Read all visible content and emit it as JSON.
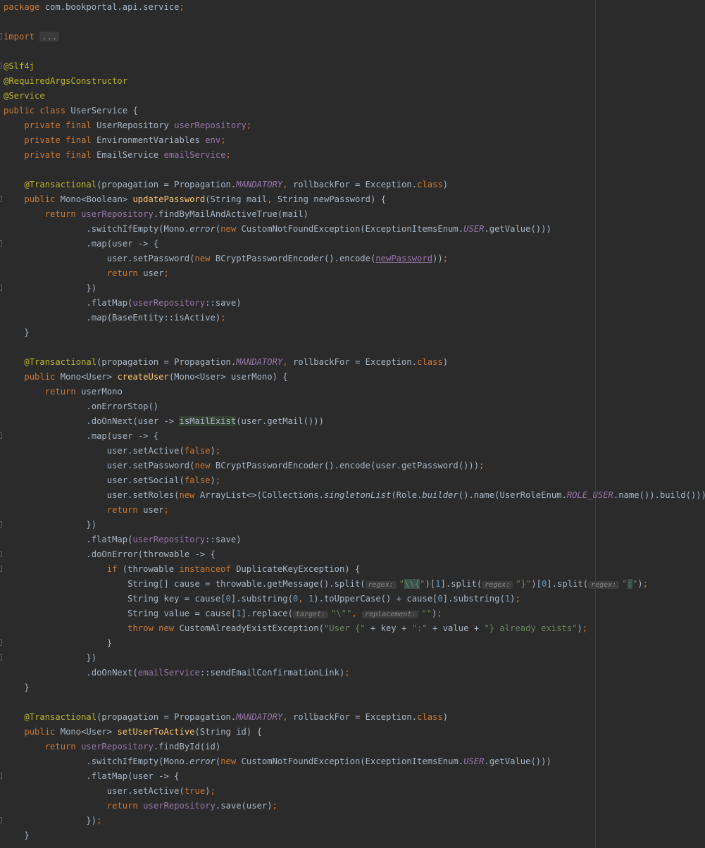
{
  "editor": {
    "language": "java",
    "colors": {
      "background": "#2b2b2b",
      "keyword": "#cc7832",
      "annotation": "#bbb529",
      "field": "#9876aa",
      "method_decl": "#ffc66d",
      "string": "#6a8759",
      "number": "#6897bb",
      "default": "#a9b7c6"
    },
    "lines": [
      [
        [
          "kw",
          "package "
        ],
        [
          "t",
          "com.bookportal.api.service"
        ],
        [
          "kw",
          ";"
        ]
      ],
      [],
      [
        [
          "kw",
          "import "
        ],
        [
          "fold",
          "..."
        ]
      ],
      [],
      [
        [
          "ann",
          "@Slf4j"
        ]
      ],
      [
        [
          "ann",
          "@RequiredArgsConstructor"
        ]
      ],
      [
        [
          "ann",
          "@Service"
        ]
      ],
      [
        [
          "kw",
          "public class "
        ],
        [
          "t",
          "UserService {"
        ]
      ],
      [
        [
          "t",
          "    "
        ],
        [
          "kw",
          "private final "
        ],
        [
          "t",
          "UserRepository "
        ],
        [
          "fld",
          "userRepository"
        ],
        [
          "kw",
          ";"
        ]
      ],
      [
        [
          "t",
          "    "
        ],
        [
          "kw",
          "private final "
        ],
        [
          "t",
          "EnvironmentVariables "
        ],
        [
          "fld",
          "env"
        ],
        [
          "kw",
          ";"
        ]
      ],
      [
        [
          "t",
          "    "
        ],
        [
          "kw",
          "private final "
        ],
        [
          "t",
          "EmailService "
        ],
        [
          "fld",
          "emailService"
        ],
        [
          "kw",
          ";"
        ]
      ],
      [],
      [
        [
          "t",
          "    "
        ],
        [
          "ann",
          "@Transactional"
        ],
        [
          "t",
          "(propagation = Propagation."
        ],
        [
          "fldit",
          "MANDATORY"
        ],
        [
          "kw",
          ","
        ],
        [
          "t",
          " rollbackFor = Exception."
        ],
        [
          "kw",
          "class"
        ],
        [
          "t",
          ")"
        ]
      ],
      [
        [
          "t",
          "    "
        ],
        [
          "kw",
          "public "
        ],
        [
          "t",
          "Mono<Boolean> "
        ],
        [
          "fn",
          "updatePassword"
        ],
        [
          "t",
          "(String mail"
        ],
        [
          "kw",
          ","
        ],
        [
          "t",
          " String newPassword) {"
        ]
      ],
      [
        [
          "t",
          "        "
        ],
        [
          "kw",
          "return "
        ],
        [
          "fld",
          "userRepository"
        ],
        [
          "t",
          ".findByMailAndActiveTrue(mail)"
        ]
      ],
      [
        [
          "t",
          "                .switchIfEmpty(Mono."
        ],
        [
          "it",
          "error"
        ],
        [
          "t",
          "("
        ],
        [
          "kw",
          "new "
        ],
        [
          "t",
          "CustomNotFoundException(ExceptionItemsEnum."
        ],
        [
          "fldit",
          "USER"
        ],
        [
          "t",
          ".getValue()))"
        ]
      ],
      [
        [
          "t",
          "                .map(user -> {"
        ]
      ],
      [
        [
          "t",
          "                    user.setPassword("
        ],
        [
          "kw",
          "new "
        ],
        [
          "t",
          "BCryptPasswordEncoder().encode("
        ],
        [
          "ulf",
          "newPassword"
        ],
        [
          "t",
          "))"
        ],
        [
          "kw",
          ";"
        ]
      ],
      [
        [
          "t",
          "                    "
        ],
        [
          "kw",
          "return "
        ],
        [
          "t",
          "user"
        ],
        [
          "kw",
          ";"
        ]
      ],
      [
        [
          "t",
          "                })"
        ]
      ],
      [
        [
          "t",
          "                .flatMap("
        ],
        [
          "fld",
          "userRepository"
        ],
        [
          "t",
          "::save)"
        ]
      ],
      [
        [
          "t",
          "                .map(BaseEntity::isActive)"
        ],
        [
          "kw",
          ";"
        ]
      ],
      [
        [
          "t",
          "    }"
        ]
      ],
      [],
      [
        [
          "t",
          "    "
        ],
        [
          "ann",
          "@Transactional"
        ],
        [
          "t",
          "(propagation = Propagation."
        ],
        [
          "fldit",
          "MANDATORY"
        ],
        [
          "kw",
          ","
        ],
        [
          "t",
          " rollbackFor = Exception."
        ],
        [
          "kw",
          "class"
        ],
        [
          "t",
          ")"
        ]
      ],
      [
        [
          "t",
          "    "
        ],
        [
          "kw",
          "public "
        ],
        [
          "t",
          "Mono<User> "
        ],
        [
          "fn",
          "createUser"
        ],
        [
          "t",
          "(Mono<User> userMono) {"
        ]
      ],
      [
        [
          "t",
          "        "
        ],
        [
          "kw",
          "return "
        ],
        [
          "t",
          "userMono"
        ]
      ],
      [
        [
          "t",
          "                .onErrorStop()"
        ]
      ],
      [
        [
          "t",
          "                .doOnNext(user -> "
        ],
        [
          "hl",
          "isMailExist"
        ],
        [
          "t",
          "(user.getMail()))"
        ]
      ],
      [
        [
          "t",
          "                .map(user -> {"
        ]
      ],
      [
        [
          "t",
          "                    user.setActive("
        ],
        [
          "kw",
          "false"
        ],
        [
          "t",
          ")"
        ],
        [
          "kw",
          ";"
        ]
      ],
      [
        [
          "t",
          "                    user.setPassword("
        ],
        [
          "kw",
          "new "
        ],
        [
          "t",
          "BCryptPasswordEncoder().encode(user.getPassword()))"
        ],
        [
          "kw",
          ";"
        ]
      ],
      [
        [
          "t",
          "                    user.setSocial("
        ],
        [
          "kw",
          "false"
        ],
        [
          "t",
          ")"
        ],
        [
          "kw",
          ";"
        ]
      ],
      [
        [
          "t",
          "                    user.setRoles("
        ],
        [
          "kw",
          "new "
        ],
        [
          "t",
          "ArrayList<>(Collections."
        ],
        [
          "it",
          "singletonList"
        ],
        [
          "t",
          "(Role."
        ],
        [
          "it",
          "builder"
        ],
        [
          "t",
          "().name(UserRoleEnum."
        ],
        [
          "fldit",
          "ROLE_USER"
        ],
        [
          "t",
          ".name()).build()))"
        ],
        [
          "kw",
          ";"
        ]
      ],
      [
        [
          "t",
          "                    "
        ],
        [
          "kw",
          "return "
        ],
        [
          "t",
          "user"
        ],
        [
          "kw",
          ";"
        ]
      ],
      [
        [
          "t",
          "                })"
        ]
      ],
      [
        [
          "t",
          "                .flatMap("
        ],
        [
          "fld",
          "userRepository"
        ],
        [
          "t",
          "::save)"
        ]
      ],
      [
        [
          "t",
          "                .doOnError(throwable -> {"
        ]
      ],
      [
        [
          "t",
          "                    "
        ],
        [
          "kw",
          "if "
        ],
        [
          "t",
          "(throwable "
        ],
        [
          "kw",
          "instanceof "
        ],
        [
          "t",
          "DuplicateKeyException) {"
        ]
      ],
      [
        [
          "t",
          "                        String[] cause = throwable.getMessage().split("
        ],
        [
          "hint",
          "regex:"
        ],
        [
          "str",
          "\""
        ],
        [
          "hlo",
          "\\\\{"
        ],
        [
          "str",
          "\""
        ],
        [
          "t",
          ")["
        ],
        [
          "num",
          "1"
        ],
        [
          "t",
          "].split("
        ],
        [
          "hint",
          "regex:"
        ],
        [
          "str",
          "\"}\""
        ],
        [
          "t",
          ")["
        ],
        [
          "num",
          "0"
        ],
        [
          "t",
          "].split("
        ],
        [
          "hint",
          "regex:"
        ],
        [
          "str",
          "\""
        ],
        [
          "hlo",
          ":"
        ],
        [
          "str",
          "\""
        ],
        [
          "t",
          ")"
        ],
        [
          "kw",
          ";"
        ]
      ],
      [
        [
          "t",
          "                        String key = cause["
        ],
        [
          "num",
          "0"
        ],
        [
          "t",
          "].substring("
        ],
        [
          "num",
          "0"
        ],
        [
          "kw",
          ", "
        ],
        [
          "num",
          "1"
        ],
        [
          "t",
          ").toUpperCase() + cause["
        ],
        [
          "num",
          "0"
        ],
        [
          "t",
          "].substring("
        ],
        [
          "num",
          "1"
        ],
        [
          "t",
          ")"
        ],
        [
          "kw",
          ";"
        ]
      ],
      [
        [
          "t",
          "                        String value = cause["
        ],
        [
          "num",
          "1"
        ],
        [
          "t",
          "].replace("
        ],
        [
          "hint",
          "target:"
        ],
        [
          "str",
          "\"\\\"\""
        ],
        [
          "kw",
          ", "
        ],
        [
          "hint",
          "replacement:"
        ],
        [
          "str",
          "\"\""
        ],
        [
          "t",
          ")"
        ],
        [
          "kw",
          ";"
        ]
      ],
      [
        [
          "t",
          "                        "
        ],
        [
          "kw",
          "throw new "
        ],
        [
          "t",
          "CustomAlreadyExistException("
        ],
        [
          "str",
          "\"User {\""
        ],
        [
          "t",
          " + key + "
        ],
        [
          "str",
          "\":\""
        ],
        [
          "t",
          " + value + "
        ],
        [
          "str",
          "\"} already exists\""
        ],
        [
          "t",
          ")"
        ],
        [
          "kw",
          ";"
        ]
      ],
      [
        [
          "t",
          "                    }"
        ]
      ],
      [
        [
          "t",
          "                })"
        ]
      ],
      [
        [
          "t",
          "                .doOnNext("
        ],
        [
          "fld",
          "emailService"
        ],
        [
          "t",
          "::sendEmailConfirmationLink)"
        ],
        [
          "kw",
          ";"
        ]
      ],
      [
        [
          "t",
          "    }"
        ]
      ],
      [],
      [
        [
          "t",
          "    "
        ],
        [
          "ann",
          "@Transactional"
        ],
        [
          "t",
          "(propagation = Propagation."
        ],
        [
          "fldit",
          "MANDATORY"
        ],
        [
          "kw",
          ","
        ],
        [
          "t",
          " rollbackFor = Exception."
        ],
        [
          "kw",
          "class"
        ],
        [
          "t",
          ")"
        ]
      ],
      [
        [
          "t",
          "    "
        ],
        [
          "kw",
          "public "
        ],
        [
          "t",
          "Mono<User> "
        ],
        [
          "fn",
          "setUserToActive"
        ],
        [
          "t",
          "(String id) {"
        ]
      ],
      [
        [
          "t",
          "        "
        ],
        [
          "kw",
          "return "
        ],
        [
          "fld",
          "userRepository"
        ],
        [
          "t",
          ".findById(id)"
        ]
      ],
      [
        [
          "t",
          "                .switchIfEmpty(Mono."
        ],
        [
          "it",
          "error"
        ],
        [
          "t",
          "("
        ],
        [
          "kw",
          "new "
        ],
        [
          "t",
          "CustomNotFoundException(ExceptionItemsEnum."
        ],
        [
          "fldit",
          "USER"
        ],
        [
          "t",
          ".getValue()))"
        ]
      ],
      [
        [
          "t",
          "                .flatMap(user -> {"
        ]
      ],
      [
        [
          "t",
          "                    user.setActive("
        ],
        [
          "kw",
          "true"
        ],
        [
          "t",
          ")"
        ],
        [
          "kw",
          ";"
        ]
      ],
      [
        [
          "t",
          "                    "
        ],
        [
          "kw",
          "return "
        ],
        [
          "fld",
          "userRepository"
        ],
        [
          "t",
          ".save(user)"
        ],
        [
          "kw",
          ";"
        ]
      ],
      [
        [
          "t",
          "                })"
        ],
        [
          "kw",
          ";"
        ]
      ],
      [
        [
          "t",
          "    }"
        ]
      ]
    ],
    "fold_markers": [
      2,
      4,
      13,
      16,
      19,
      29,
      35,
      37,
      38,
      43,
      44,
      52,
      55
    ]
  }
}
